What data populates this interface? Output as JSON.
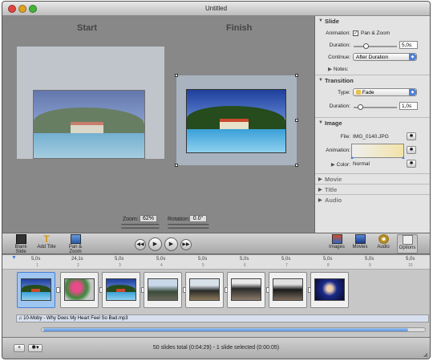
{
  "window": {
    "title": "Untitled"
  },
  "stage": {
    "start_label": "Start",
    "finish_label": "Finish",
    "zoom_label": "Zoom:",
    "zoom_value": "62%",
    "rotation_label": "Rotation:",
    "rotation_value": "0.0°"
  },
  "inspector": {
    "slide": {
      "header": "Slide",
      "animation_label": "Animation:",
      "animation_option": "Pan & Zoom",
      "animation_checked": true,
      "duration_label": "Duration:",
      "duration_value": "5,0s",
      "continue_label": "Continue:",
      "continue_value": "After Duration",
      "notes_label": "Notes:"
    },
    "transition": {
      "header": "Transition",
      "type_label": "Type:",
      "type_value": "Fade",
      "duration_label": "Duration:",
      "duration_value": "1,0s"
    },
    "image": {
      "header": "Image",
      "file_label": "File:",
      "file_value": "IMG_0140.JPG",
      "animation_label": "Animation:",
      "color_label": "Color:",
      "color_value": "Normal"
    },
    "movie": {
      "header": "Movie"
    },
    "title": {
      "header": "Title"
    },
    "audio": {
      "header": "Audio"
    }
  },
  "toolbar": {
    "blank_slide": "Blank Slide",
    "add_title": "Add Title",
    "pan_zoom": "Pan & Zoom",
    "images": "Images",
    "movies": "Movies",
    "audio": "Audio",
    "options": "Options"
  },
  "timeline": {
    "durations": [
      "5,0s",
      "24,1s",
      "5,0s",
      "5,0s",
      "5,0s",
      "5,0s",
      "5,0s",
      "5,0s",
      "5,0s",
      "5,0s"
    ],
    "numbers": [
      "1",
      "2",
      "3",
      "4",
      "5",
      "6",
      "7",
      "8",
      "9",
      "10"
    ],
    "audio_track": "10-Moby - Why Does My Heart Feel So Bad.mp3"
  },
  "status": {
    "text": "50 slides total (0:04:29) - 1 slide selected (0:00:05)"
  },
  "colors": {
    "accent": "#4a7ed8",
    "stage_bg": "#888888",
    "inspector_bg": "#e3e3e3"
  }
}
